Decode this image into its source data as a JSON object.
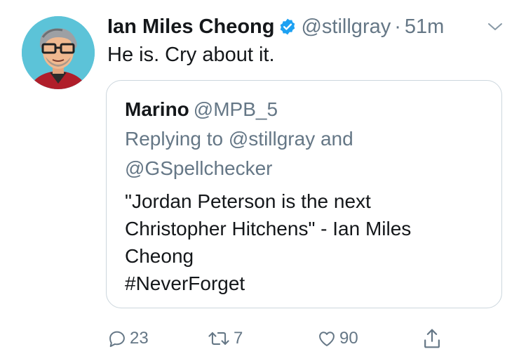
{
  "tweet": {
    "author_name": "Ian Miles Cheong",
    "author_handle": "@stillgray",
    "separator": "·",
    "time": "51m",
    "text": "He is. Cry about it."
  },
  "quoted": {
    "author_name": "Marino",
    "author_handle": "@MPB_5",
    "reply_lines": [
      "Replying to @stillgray and",
      "@GSpellchecker"
    ],
    "body_lines": [
      "\"Jordan Peterson is the next",
      "Christopher Hitchens\" - Ian Miles",
      "Cheong",
      "#NeverForget"
    ]
  },
  "actions": {
    "reply_count": "23",
    "retweet_count": "7",
    "like_count": "90"
  },
  "icons": {
    "verified": "verified-badge-icon",
    "menu": "chevron-down-icon",
    "reply": "reply-icon",
    "retweet": "retweet-icon",
    "like": "heart-icon",
    "share": "share-icon"
  },
  "colors": {
    "text": "#14171a",
    "secondary": "#657786",
    "verified_blue": "#1da1f2",
    "border": "#ccd6dd"
  }
}
